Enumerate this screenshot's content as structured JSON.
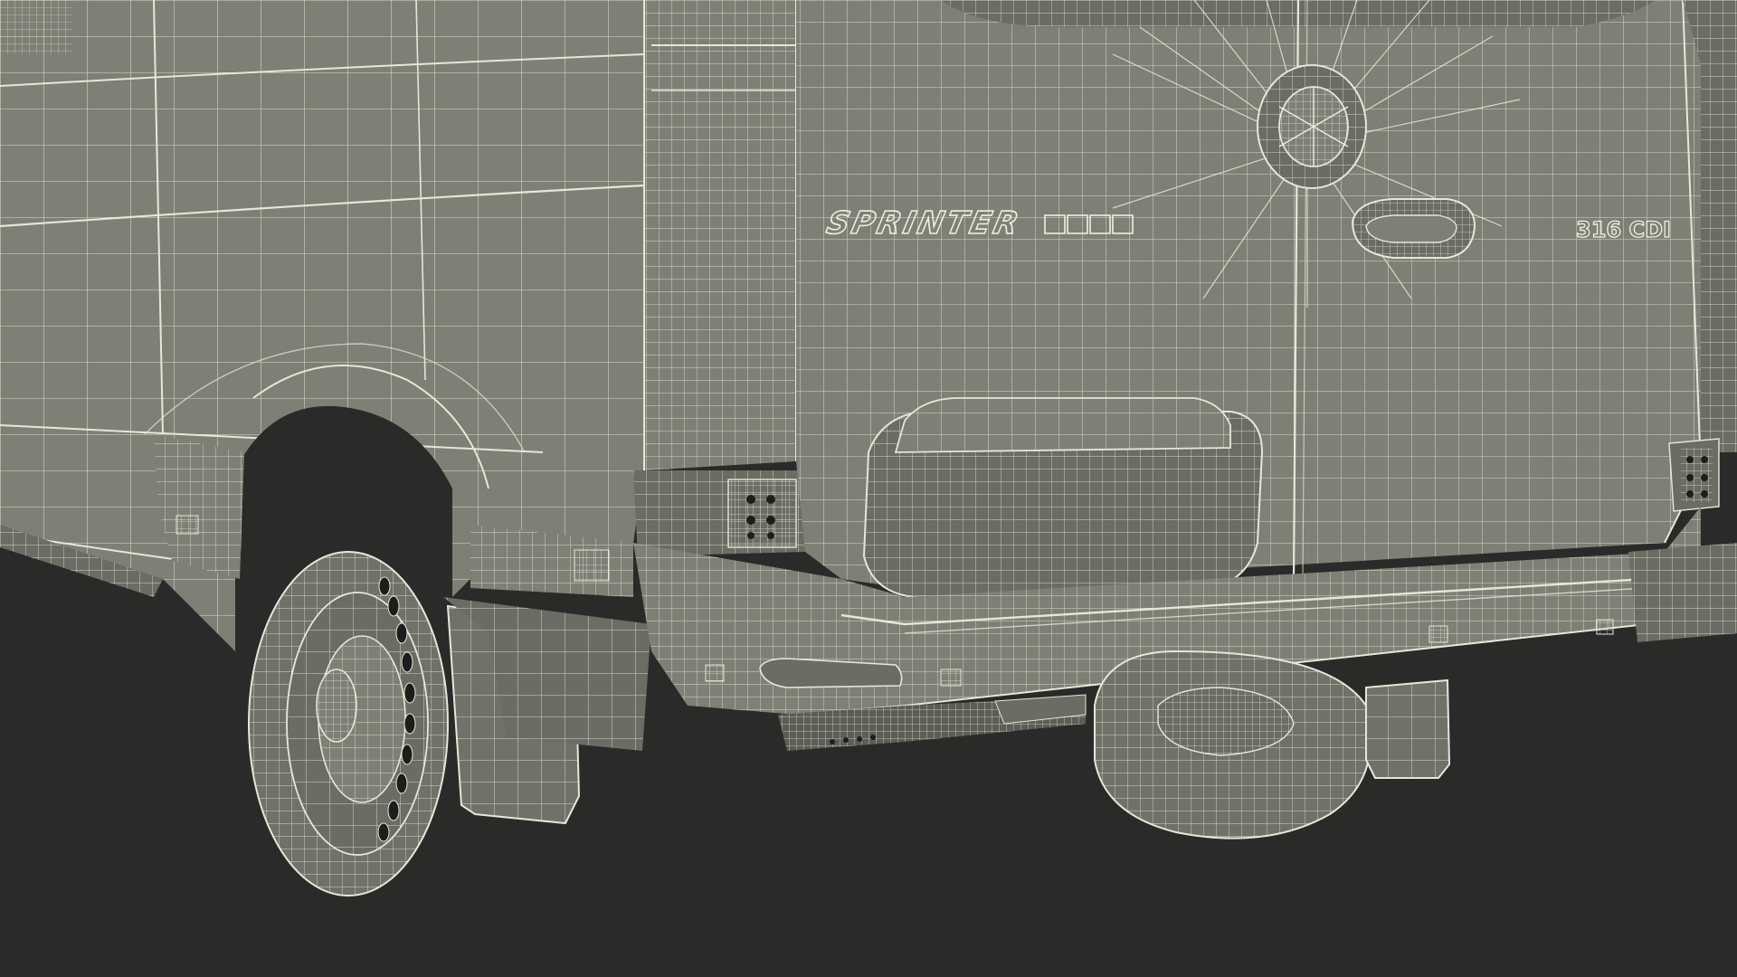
{
  "scene": {
    "subject": "wireframe-van-rear",
    "colors": {
      "background": "#2a2a29",
      "body": "#7f7f75",
      "body_shade": "#6c6c64",
      "body_dark": "#5d5d56",
      "tire": "#717169",
      "tire_dark": "#5c5c55",
      "wheel_hole": "#1d1d1b",
      "wire": "#e8e6d8",
      "wire_dense": "#f0eee2"
    }
  },
  "badges": {
    "model": "SPRINTER",
    "variant": "316 CDI"
  }
}
